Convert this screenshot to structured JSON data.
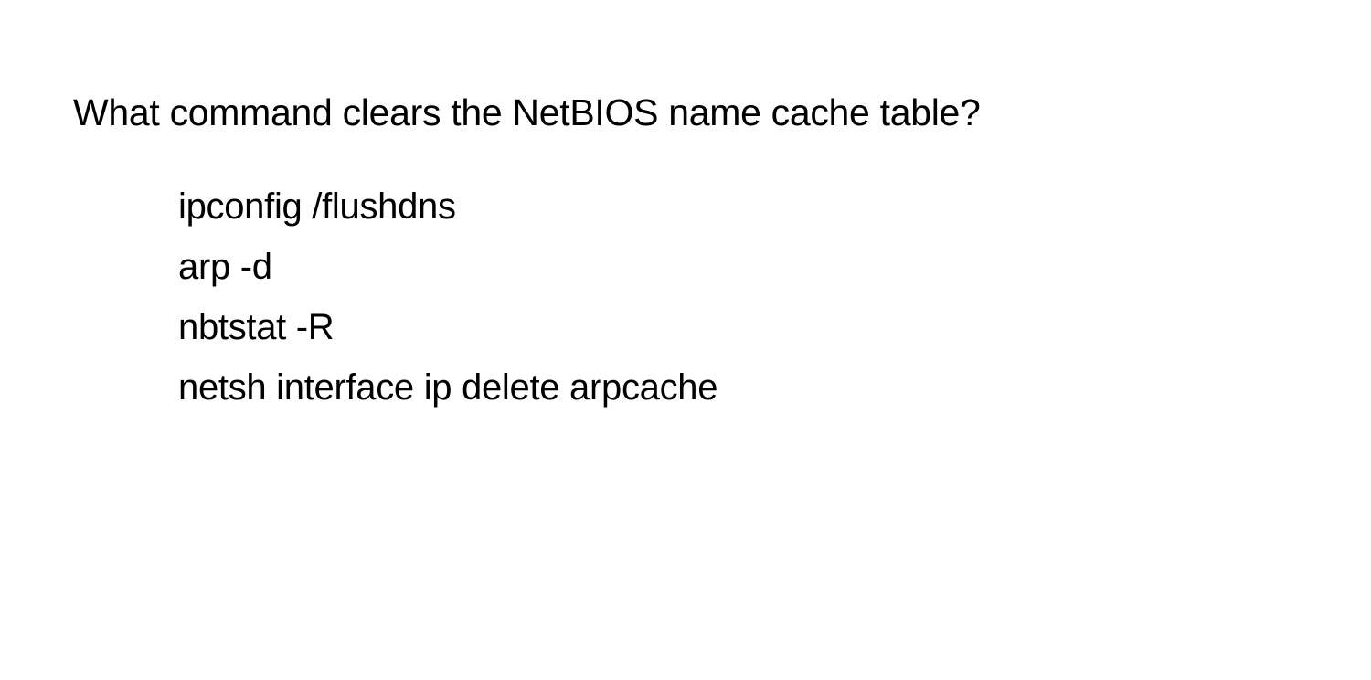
{
  "question": "What command clears the NetBIOS name cache table?",
  "options": [
    "ipconfig /flushdns",
    "arp -d",
    "nbtstat -R",
    "netsh interface ip delete arpcache"
  ]
}
